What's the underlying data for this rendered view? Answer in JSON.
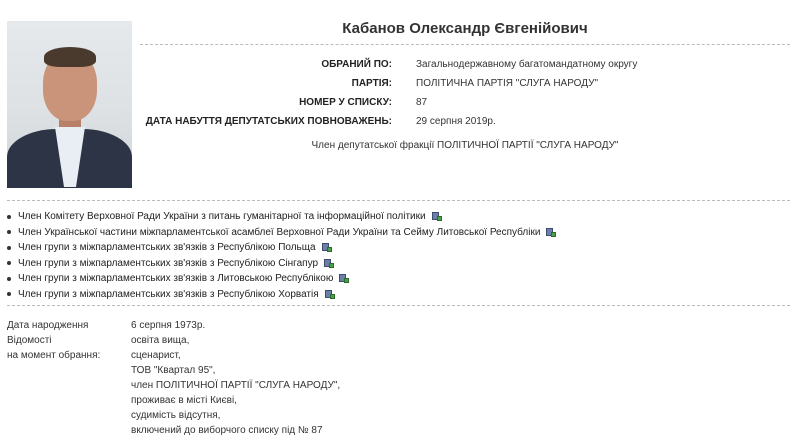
{
  "deputy": {
    "name": "Кабанов Олександр Євгенійович",
    "fields": [
      {
        "label": "ОБРАНИЙ ПО:",
        "value": "Загальнодержавному багатомандатному округу"
      },
      {
        "label": "ПАРТІЯ:",
        "value": "ПОЛІТИЧНА ПАРТІЯ \"СЛУГА НАРОДУ\""
      },
      {
        "label": "НОМЕР У СПИСКУ:",
        "value": "87"
      },
      {
        "label": "ДАТА НАБУТТЯ ДЕПУТАТСЬКИХ ПОВНОВАЖЕНЬ:",
        "value": "29 серпня 2019р."
      }
    ],
    "faction": "Член депутатської фракції ПОЛІТИЧНОЇ ПАРТІЇ \"СЛУГА НАРОДУ\""
  },
  "roles": [
    "Член Комітету Верховної Ради України з питань гуманітарної та інформаційної політики",
    "Член Української частини міжпарламентської асамблеї Верховної Ради України та Сейму Литовської Республіки",
    "Член групи з міжпарламентських зв'язків з Республікою Польща",
    "Член групи з міжпарламентських зв'язків з Республікою Сінгапур",
    "Член групи з міжпарламентських зв'язків з Литовською Республікою",
    "Член групи з міжпарламентських зв'язків з Республікою Хорватія"
  ],
  "bio": {
    "birth_label": "Дата народження",
    "birth_value": "6 серпня 1973р.",
    "info_label_1": "Відомості",
    "info_label_2": "на момент обрання:",
    "info_lines": [
      "освіта вища,",
      "сценарист,",
      "ТОВ \"Квартал 95\",",
      "член ПОЛІТИЧНОЇ ПАРТІЇ \"СЛУГА НАРОДУ\",",
      "проживає в місті Києві,",
      "судимість відсутня,",
      "включений до виборчого списку під № 87"
    ]
  },
  "icons": {
    "role_doc": "document-export-icon"
  }
}
